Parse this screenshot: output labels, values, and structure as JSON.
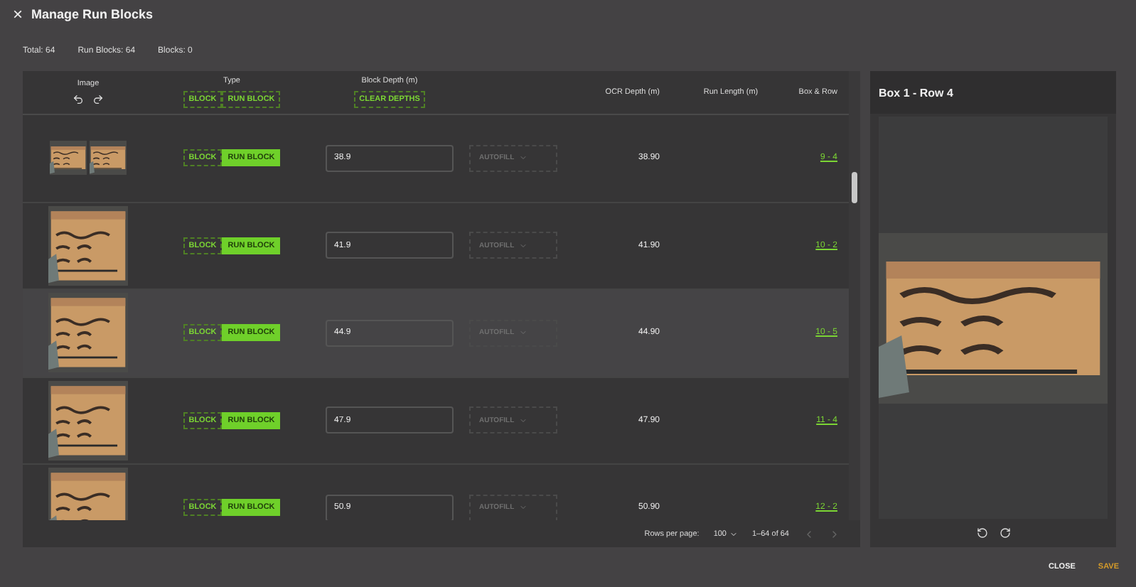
{
  "window": {
    "close_icon": "×",
    "title": "Manage Run Blocks"
  },
  "stats": [
    "Total: 64",
    "Run Blocks: 64",
    "Blocks: 0"
  ],
  "table": {
    "columns": [
      {
        "label": "Image"
      },
      {
        "label": "Type"
      },
      {
        "label": "Block Depth (m)"
      },
      {
        "label": "OCR Depth (m)"
      },
      {
        "label": "Run Length (m)"
      },
      {
        "label": "Box & Row"
      }
    ],
    "type_filter": [
      {
        "label": "BLOCK",
        "selected": false
      },
      {
        "label": "RUN BLOCK",
        "selected": false
      }
    ],
    "clear_button": "CLEAR DEPTHS",
    "rows": [
      {
        "highlighted": false,
        "images": [
          {
            "kind": "picture"
          },
          {
            "kind": "picture"
          }
        ],
        "types": [
          {
            "label": "BLOCK",
            "selected": false
          },
          {
            "label": "RUN BLOCK",
            "selected": true
          }
        ],
        "depth": "38.9",
        "autofill": "AUTOFILL",
        "ocr": "38.90",
        "box_row": "9 - 4"
      },
      {
        "highlighted": false,
        "images": [
          {
            "kind": "picture"
          }
        ],
        "types": [
          {
            "label": "BLOCK",
            "selected": false
          },
          {
            "label": "RUN BLOCK",
            "selected": true
          }
        ],
        "depth": "41.9",
        "autofill": "AUTOFILL",
        "ocr": "41.90",
        "box_row": "10 - 2"
      },
      {
        "highlighted": true,
        "images": [
          {
            "kind": "picture"
          }
        ],
        "types": [
          {
            "label": "BLOCK",
            "selected": false
          },
          {
            "label": "RUN BLOCK",
            "selected": true
          }
        ],
        "depth": "44.9",
        "autofill": "AUTOFILL",
        "ocr": "44.90",
        "box_row": "10 - 5"
      },
      {
        "highlighted": false,
        "images": [
          {
            "kind": "picture"
          }
        ],
        "types": [
          {
            "label": "BLOCK",
            "selected": false
          },
          {
            "label": "RUN BLOCK",
            "selected": true
          }
        ],
        "depth": "47.9",
        "autofill": "AUTOFILL",
        "ocr": "47.90",
        "box_row": "11 - 4"
      },
      {
        "highlighted": false,
        "images": [
          {
            "kind": "picture"
          }
        ],
        "types": [
          {
            "label": "BLOCK",
            "selected": false
          },
          {
            "label": "RUN BLOCK",
            "selected": true
          }
        ],
        "depth": "50.9",
        "autofill": "AUTOFILL",
        "ocr": "50.90",
        "box_row": "12 - 2"
      }
    ],
    "pagination": {
      "rows_label": "Rows per page:",
      "rows_value": "100",
      "range": "1–64 of 64"
    }
  },
  "preview": {
    "title": "Box 1 - Row 4",
    "image": {
      "kind": "picture"
    }
  },
  "actions": [
    {
      "label": "CLOSE",
      "kind": "secondary"
    },
    {
      "label": "SAVE",
      "kind": "primary"
    }
  ]
}
